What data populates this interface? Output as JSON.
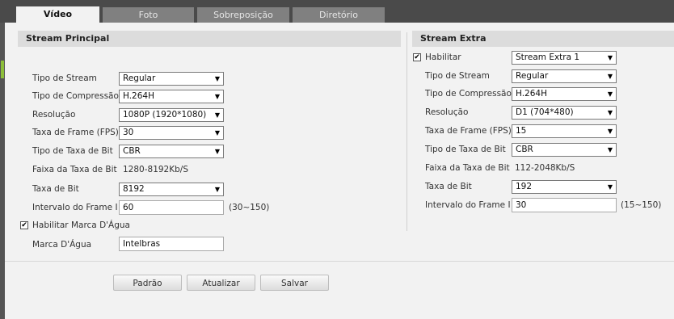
{
  "tabs": [
    {
      "label": "Vídeo",
      "active": true
    },
    {
      "label": "Foto",
      "active": false
    },
    {
      "label": "Sobreposição",
      "active": false
    },
    {
      "label": "Diretório",
      "active": false
    }
  ],
  "main": {
    "title": "Stream Principal",
    "tipo_stream": {
      "label": "Tipo de Stream",
      "value": "Regular"
    },
    "tipo_compressao": {
      "label": "Tipo de Compressão",
      "value": "H.264H"
    },
    "resolucao": {
      "label": "Resolução",
      "value": "1080P (1920*1080)"
    },
    "taxa_frame": {
      "label": "Taxa de Frame (FPS)",
      "value": "30"
    },
    "tipo_taxa_bit": {
      "label": "Tipo de Taxa de Bit",
      "value": "CBR"
    },
    "faixa_taxa_bit": {
      "label": "Faixa da Taxa de Bit",
      "value": "1280-8192Kb/S"
    },
    "taxa_bit": {
      "label": "Taxa de Bit",
      "value": "8192"
    },
    "intervalo_frame": {
      "label": "Intervalo do Frame I",
      "value": "60",
      "range": "(30~150)"
    },
    "marca_dagua_enable": {
      "label": "Habilitar Marca D'Água",
      "checked": true,
      "mark": "✔"
    },
    "marca_dagua": {
      "label": "Marca D'Água",
      "value": "Intelbras"
    }
  },
  "extra": {
    "title": "Stream Extra",
    "habilitar": {
      "label": "Habilitar",
      "checked": true,
      "mark": "✔",
      "value": "Stream Extra 1"
    },
    "tipo_stream": {
      "label": "Tipo de Stream",
      "value": "Regular"
    },
    "tipo_compressao": {
      "label": "Tipo de Compressão",
      "value": "H.264H"
    },
    "resolucao": {
      "label": "Resolução",
      "value": "D1 (704*480)"
    },
    "taxa_frame": {
      "label": "Taxa de Frame (FPS)",
      "value": "15"
    },
    "tipo_taxa_bit": {
      "label": "Tipo de Taxa de Bit",
      "value": "CBR"
    },
    "faixa_taxa_bit": {
      "label": "Faixa da Taxa de Bit",
      "value": "112-2048Kb/S"
    },
    "taxa_bit": {
      "label": "Taxa de Bit",
      "value": "192"
    },
    "intervalo_frame": {
      "label": "Intervalo do Frame I",
      "value": "30",
      "range": "(15~150)"
    }
  },
  "buttons": {
    "padrao": "Padrão",
    "atualizar": "Atualizar",
    "salvar": "Salvar"
  },
  "icons": {
    "dropdown": "▼"
  }
}
